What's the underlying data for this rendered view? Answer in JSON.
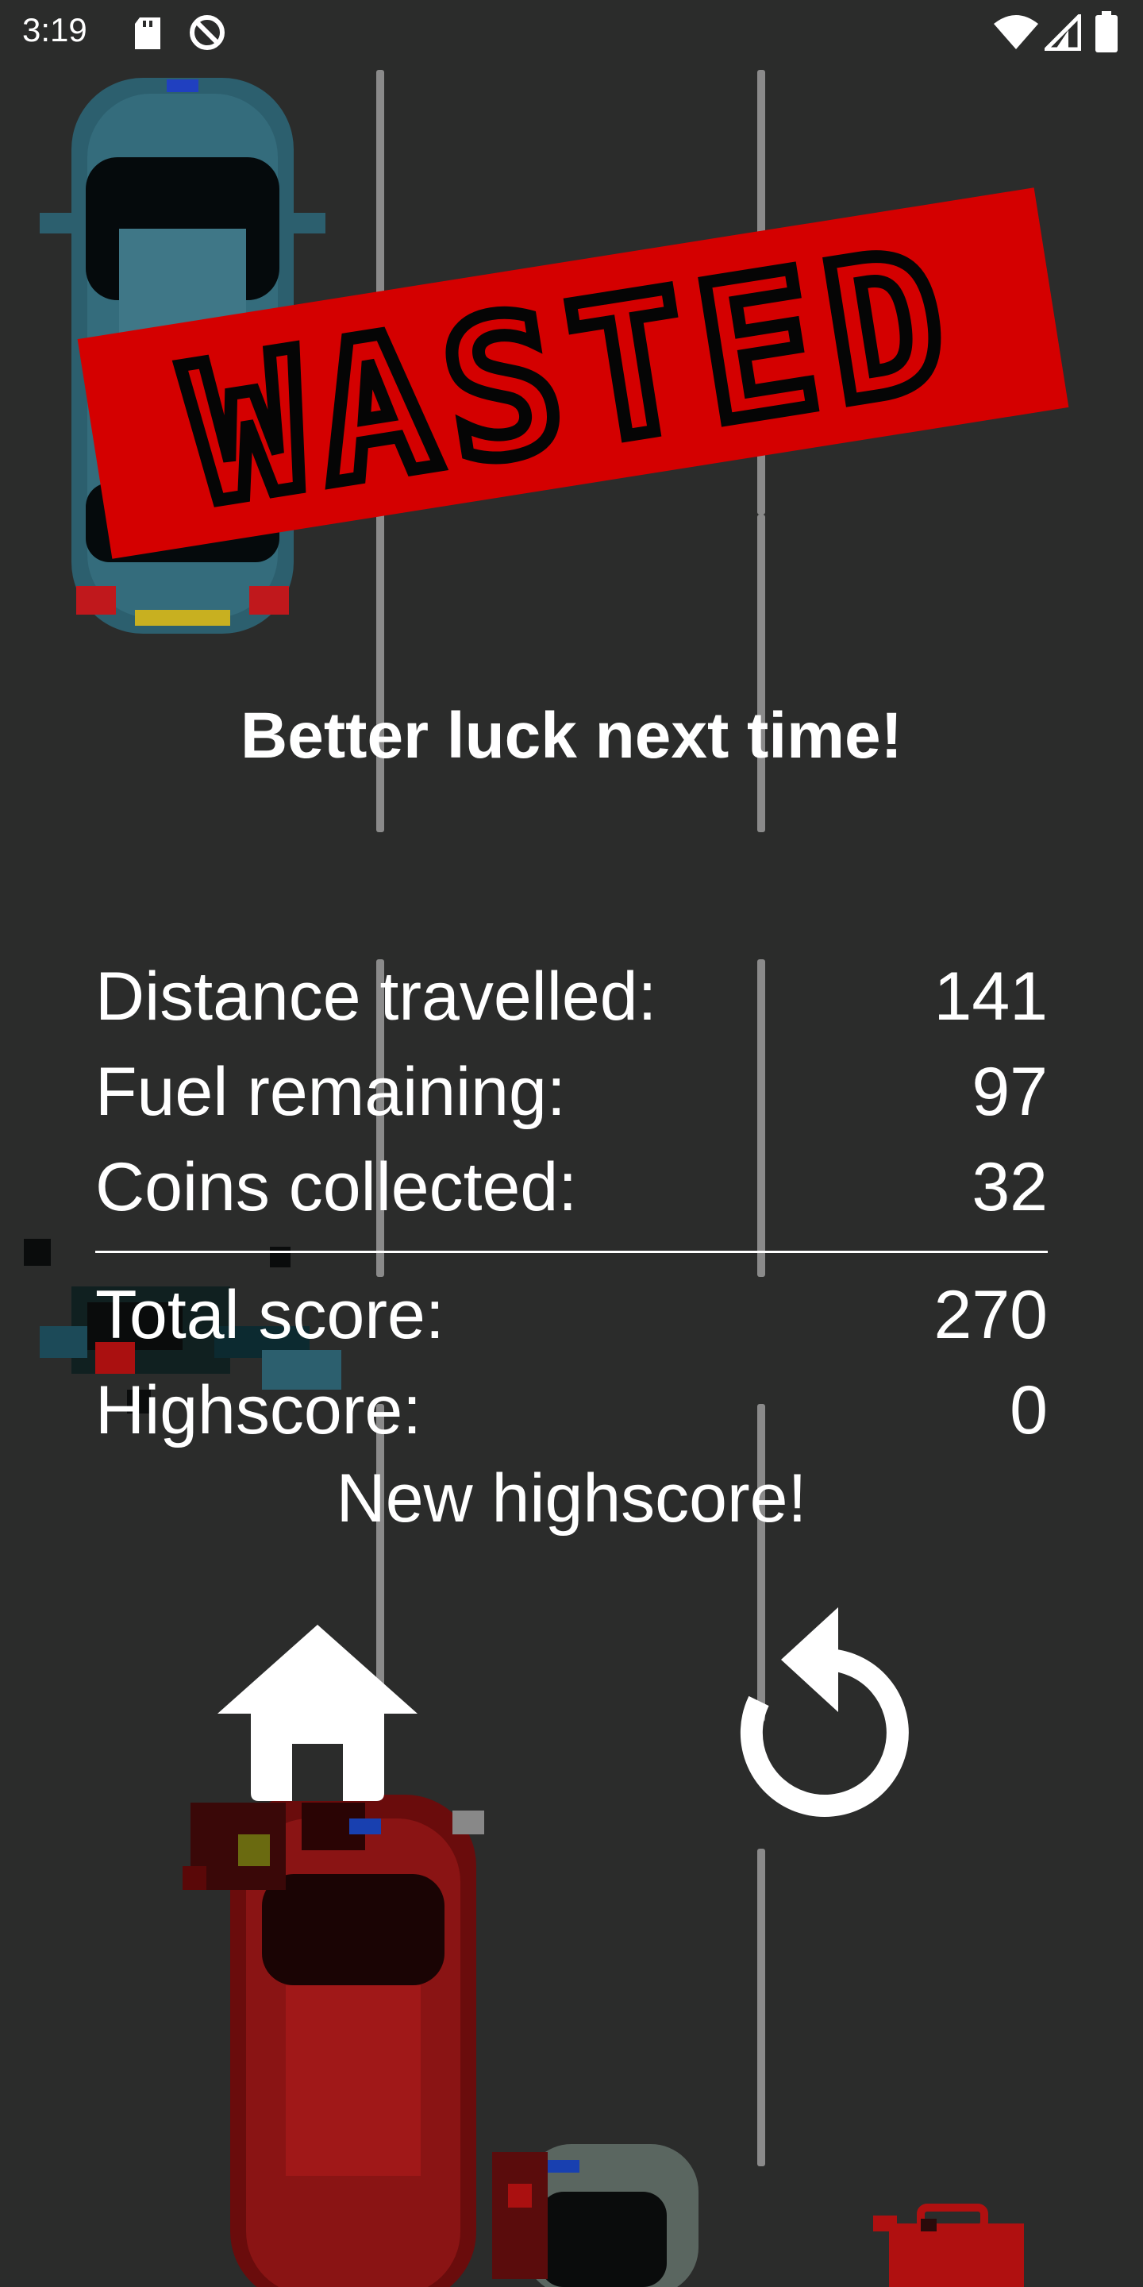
{
  "status_bar": {
    "time": "3:19",
    "icons": [
      "sd-card-icon",
      "data-saver-icon",
      "wifi-icon",
      "signal-icon",
      "battery-icon"
    ]
  },
  "banner": {
    "text": "WASTED",
    "color": "#d40000"
  },
  "message": "Better luck next time!",
  "stats": {
    "distance": {
      "label": "Distance travelled:",
      "value": "141"
    },
    "fuel": {
      "label": "Fuel remaining:",
      "value": "97"
    },
    "coins": {
      "label": "Coins collected:",
      "value": "32"
    },
    "total": {
      "label": "Total score:",
      "value": "270"
    },
    "highscore": {
      "label": "Highscore:",
      "value": "0"
    }
  },
  "new_highscore": "New highscore!",
  "buttons": {
    "home": "home-icon",
    "restart": "restart-icon"
  },
  "colors": {
    "background": "#2b2c2b",
    "lane": "#8a8a8a",
    "blue_car": "#2c5f6e",
    "red_car": "#7a1010",
    "fuel_can": "#b01010"
  }
}
